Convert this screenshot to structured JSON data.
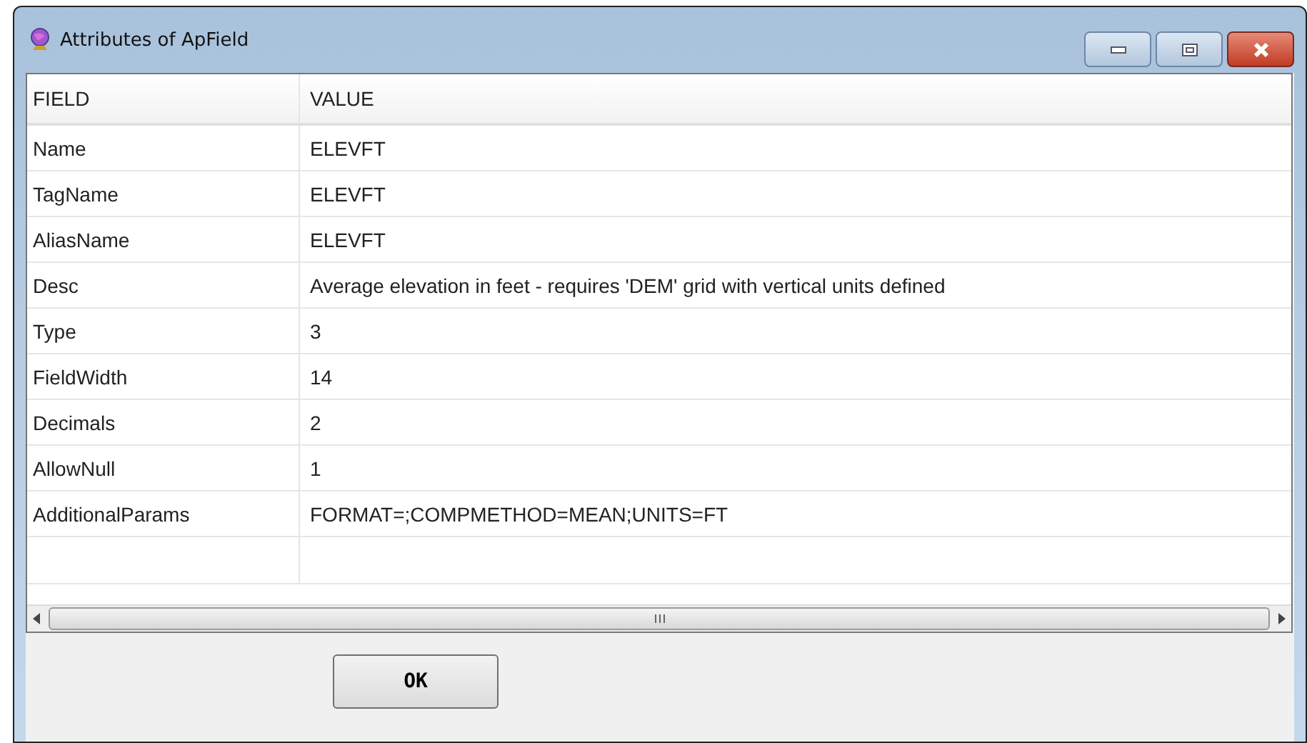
{
  "window": {
    "title": "Attributes of ApField"
  },
  "table": {
    "columns": [
      "FIELD",
      "VALUE"
    ],
    "rows": [
      [
        "Name",
        "ELEVFT"
      ],
      [
        "TagName",
        "ELEVFT"
      ],
      [
        "AliasName",
        "ELEVFT"
      ],
      [
        "Desc",
        "Average elevation in feet - requires 'DEM' grid with vertical units defined"
      ],
      [
        "Type",
        "3"
      ],
      [
        "FieldWidth",
        "14"
      ],
      [
        "Decimals",
        "2"
      ],
      [
        "AllowNull",
        "1"
      ],
      [
        "AdditionalParams",
        "FORMAT=;COMPMETHOD=MEAN;UNITS=FT"
      ]
    ]
  },
  "buttons": [
    "OK"
  ]
}
